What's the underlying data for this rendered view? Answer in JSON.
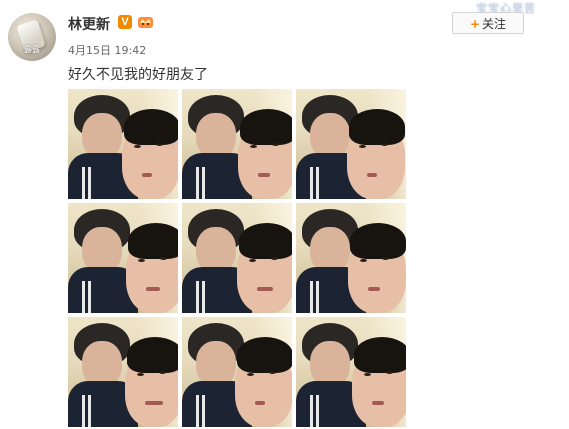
{
  "post": {
    "username": "林更新",
    "verified_badge": "V",
    "timestamp": "4月15日 19:42",
    "text": "好久不见我的好朋友了",
    "avatar_text": "露露",
    "icons": [
      "verified-v-icon",
      "member-crown-icon",
      "plus-icon"
    ]
  },
  "header": {
    "follow_label": "关注",
    "follow_plus": "+",
    "watermark": "宝宝心里苦"
  },
  "gallery": {
    "rows": 3,
    "columns": 3,
    "photos": [
      {
        "id": 1
      },
      {
        "id": 2
      },
      {
        "id": 3
      },
      {
        "id": 4
      },
      {
        "id": 5
      },
      {
        "id": 6
      },
      {
        "id": 7
      },
      {
        "id": 8
      },
      {
        "id": 9
      }
    ]
  },
  "colors": {
    "accent_orange": "#ff8200",
    "verified_orange": "#f08a00",
    "text": "#333333",
    "muted": "#666666"
  }
}
